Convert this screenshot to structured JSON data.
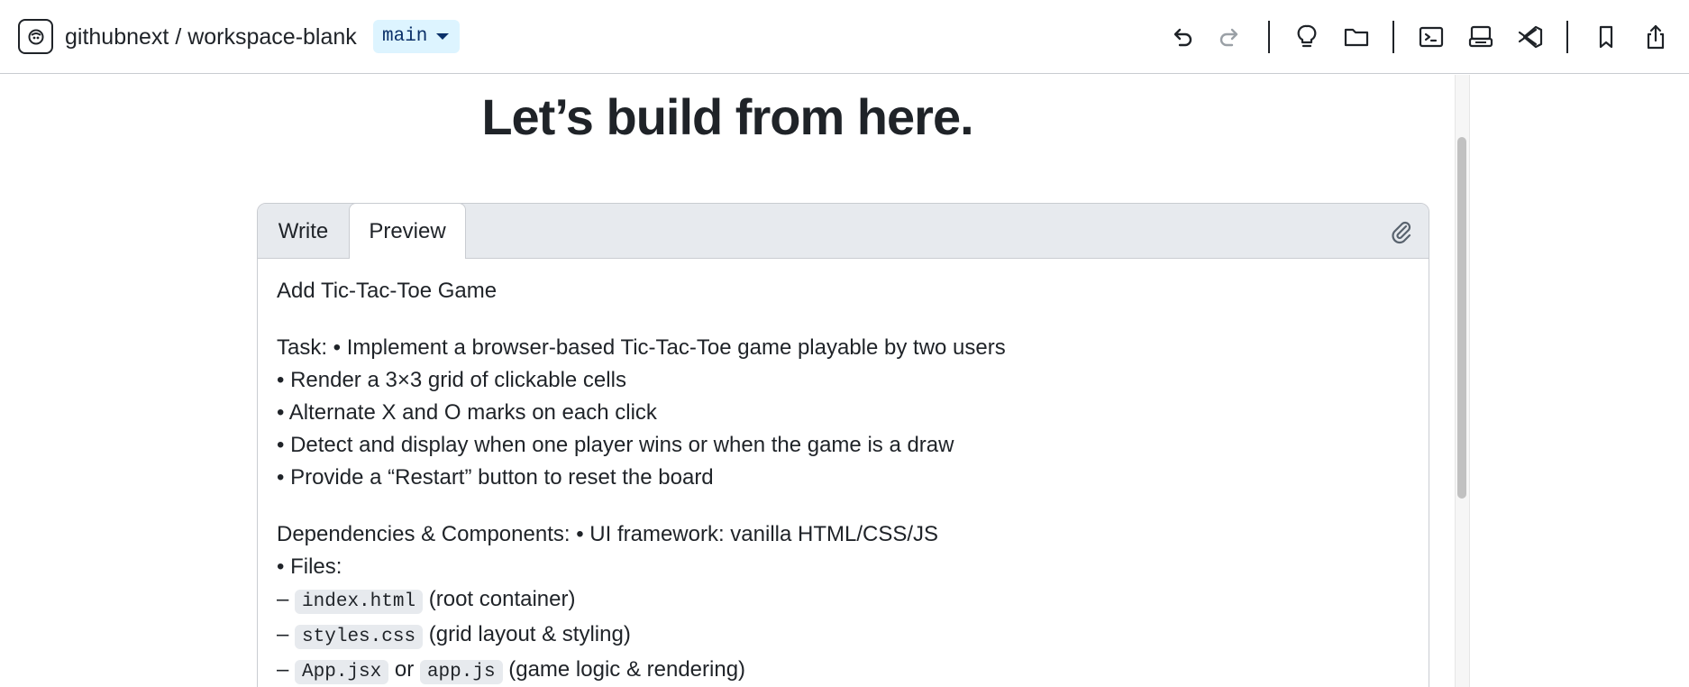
{
  "header": {
    "repo_path": "githubnext / workspace-blank",
    "branch": "main",
    "tools": [
      "undo-icon",
      "redo-icon",
      "lightbulb-icon",
      "folder-icon",
      "terminal-icon",
      "server-icon",
      "vscode-icon",
      "bookmark-icon",
      "share-icon"
    ]
  },
  "hero": {
    "title": "Let’s build from here."
  },
  "editor": {
    "tabs": {
      "write": "Write",
      "preview": "Preview"
    },
    "preview": {
      "title": "Add Tic-Tac-Toe Game",
      "task_lines": [
        "Task: • Implement a browser-based Tic-Tac-Toe game playable by two users",
        "• Render a 3×3 grid of clickable cells",
        "• Alternate X and O marks on each click",
        "• Detect and display when one player wins or when the game is a draw",
        "• Provide a “Restart” button to reset the board"
      ],
      "deps_line": "Dependencies & Components: • UI framework: vanilla HTML/CSS/JS",
      "files_label": "• Files:",
      "dash": "–",
      "file1": {
        "code": "index.html",
        "desc": "(root container)"
      },
      "file2": {
        "code": "styles.css",
        "desc": "(grid layout & styling)"
      },
      "file3": {
        "code": "App.jsx",
        "or": "or",
        "code2": "app.js",
        "desc": "(game logic & rendering)"
      }
    }
  },
  "colors": {
    "branch_bg": "#ddf4ff",
    "branch_fg": "#0a3069",
    "tab_bar": "#e7eaee",
    "code_bg": "#e7eaee"
  }
}
